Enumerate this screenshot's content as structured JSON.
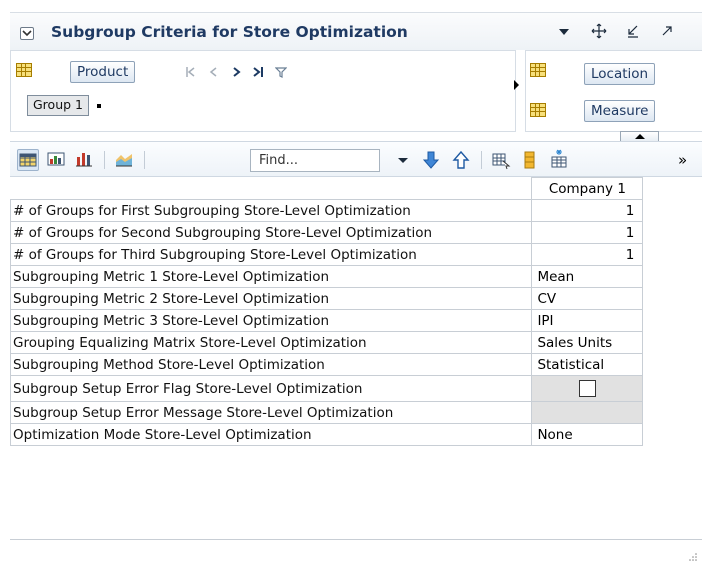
{
  "window": {
    "title": "Subgroup Criteria for Store Optimization",
    "menu_icon": "caret-down-icon",
    "move_icon": "move-icon",
    "minimize_icon": "minimize-icon",
    "maximize_icon": "maximize-icon"
  },
  "layout_pane": {
    "row_dimension": "Product",
    "row_group_label": "Group 1",
    "column_dimensions": [
      "Location",
      "Measure"
    ],
    "nav_icons": [
      "first-icon",
      "previous-icon",
      "next-icon",
      "last-icon",
      "filter-icon"
    ]
  },
  "toolbar": {
    "find_placeholder": "Find...",
    "buttons": [
      "table-view-icon",
      "chart-table-icon",
      "bar-chart-icon",
      "area-chart-icon",
      "find-dropdown-icon",
      "find-next-icon",
      "find-previous-icon",
      "export-icon",
      "highlight-icon",
      "settings-icon",
      "overflow-icon"
    ],
    "overflow_label": "»"
  },
  "table": {
    "column_header": "Company 1",
    "rows": [
      {
        "label": "# of Groups for First Subgrouping Store-Level Optimization",
        "value": "1",
        "type": "number"
      },
      {
        "label": "# of Groups for Second Subgrouping Store-Level Optimization",
        "value": "1",
        "type": "number"
      },
      {
        "label": "# of Groups for Third Subgrouping Store-Level Optimization",
        "value": "1",
        "type": "number"
      },
      {
        "label": "Subgrouping Metric 1 Store-Level Optimization",
        "value": "Mean",
        "type": "text"
      },
      {
        "label": "Subgrouping Metric 2 Store-Level Optimization",
        "value": "CV",
        "type": "text"
      },
      {
        "label": "Subgrouping Metric 3 Store-Level Optimization",
        "value": "IPI",
        "type": "text"
      },
      {
        "label": "Grouping Equalizing Matrix Store-Level Optimization",
        "value": "Sales Units",
        "type": "text"
      },
      {
        "label": "Subgrouping Method Store-Level Optimization",
        "value": "Statistical",
        "type": "text"
      },
      {
        "label": "Subgroup Setup Error Flag Store-Level Optimization",
        "value": "",
        "type": "checkbox",
        "checked": false
      },
      {
        "label": "Subgroup Setup Error Message Store-Level Optimization",
        "value": "",
        "type": "readonly"
      },
      {
        "label": "Optimization Mode Store-Level Optimization",
        "value": "None",
        "type": "text"
      }
    ]
  }
}
